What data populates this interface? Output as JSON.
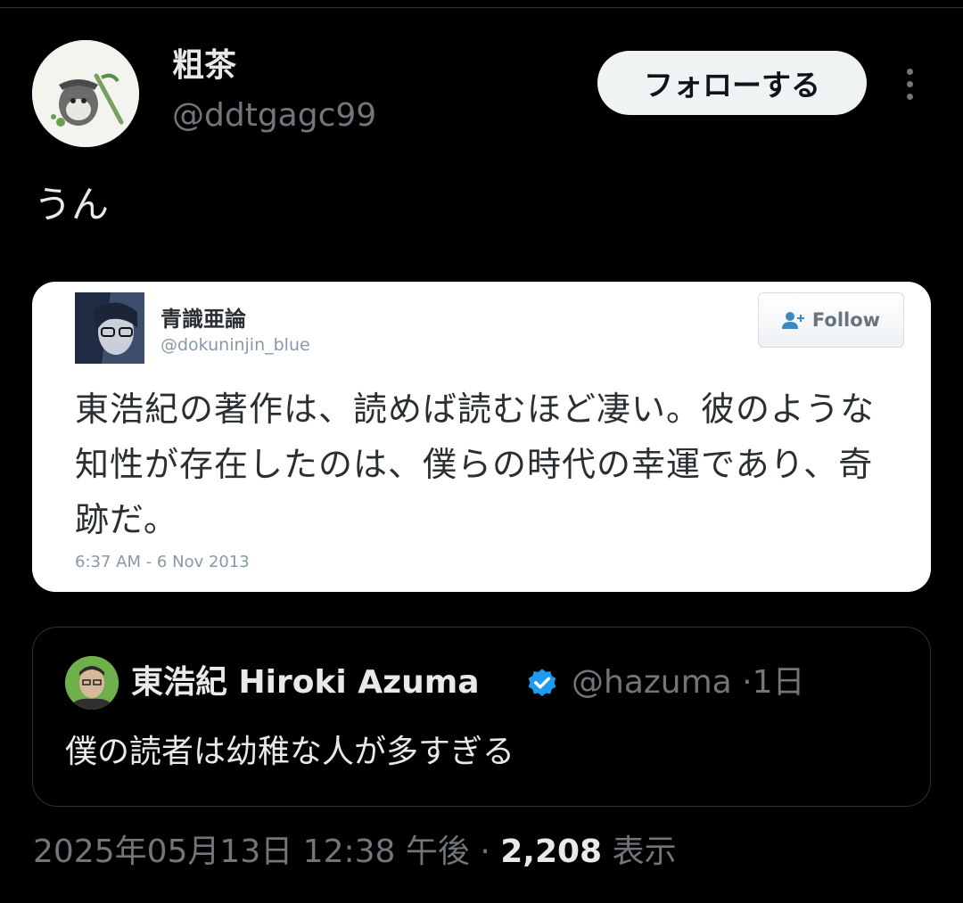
{
  "author": {
    "display_name": "粗茶",
    "handle": "@ddtgagc99",
    "follow_label": "フォローする"
  },
  "tweet": {
    "text": "うん"
  },
  "embedded_image": {
    "name": "青識亜論",
    "handle": "@dokuninjin_blue",
    "follow_label": "Follow",
    "text": "東浩紀の著作は、読めば読むほど凄い。彼のような知性が存在したのは、僕らの時代の幸運であり、奇跡だ。",
    "timestamp": "6:37 AM - 6 Nov 2013"
  },
  "quoted_tweet": {
    "name": "東浩紀 Hiroki Azuma",
    "handle": "@hazuma",
    "separator": "·",
    "age": "1日",
    "text": "僕の読者は幼稚な人が多すぎる"
  },
  "meta": {
    "timestamp": "2025年05月13日 12:38 午後",
    "separator": "·",
    "views_count": "2,208",
    "views_label": "表示"
  },
  "colors": {
    "background": "#000000",
    "text": "#e7e9ea",
    "muted": "#71767b",
    "verified": "#1d9bf0",
    "border": "#2f3336"
  }
}
